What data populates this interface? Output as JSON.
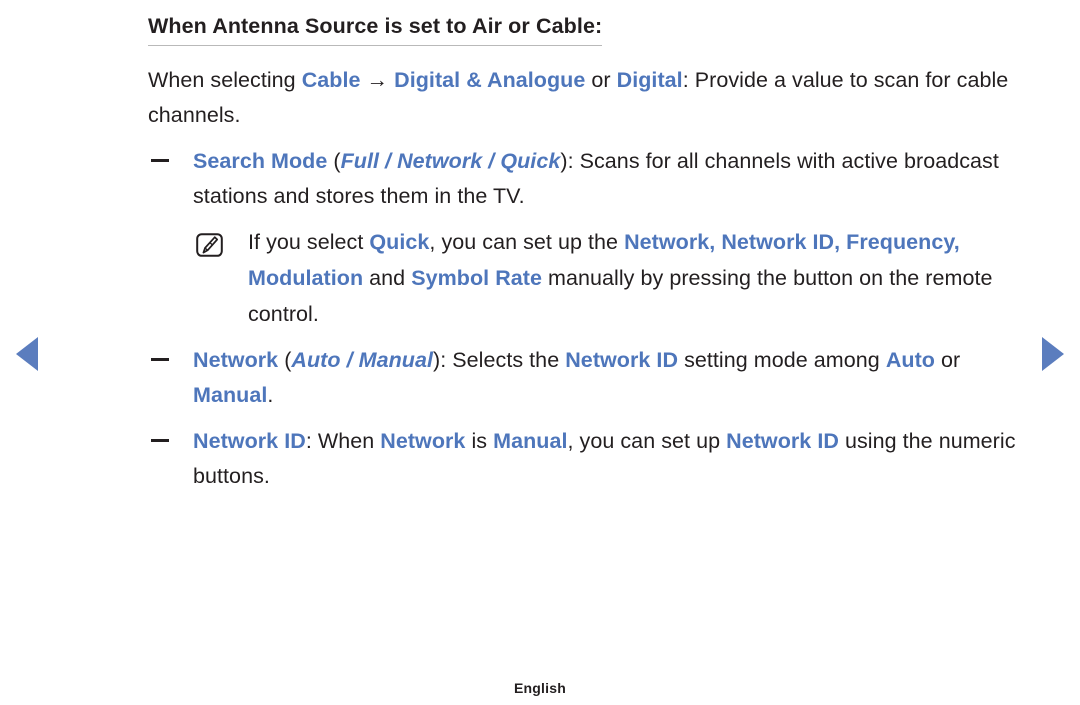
{
  "document": {
    "title": "When Antenna Source is set to Air or Cable:",
    "footer_language": "English"
  },
  "navigation": {
    "prev_label": "◀",
    "next_label": "▶"
  },
  "colors": {
    "highlight_blue": "#4e76bb",
    "text_dark": "#231f20",
    "rule_gray": "#b9b9b9",
    "arrow_blue": "#5b7dbe"
  },
  "icons": {
    "note": "note-pencil-icon"
  },
  "intro": {
    "p1_a": "When selecting ",
    "p1_cable": "Cable",
    "p1_arrow": " → ",
    "p1_digital_analogue": "Digital & Analogue",
    "p1_b": " or ",
    "p1_digital": "Digital",
    "p1_c": ": Provide a value to scan for cable channels."
  },
  "bullets": [
    {
      "term": "Search Mode",
      "open_paren": " (",
      "options": "Full / Network / Quick",
      "close_paren": ")",
      "body": ": Scans for all channels with active broadcast stations and stores them in the TV."
    },
    {
      "term": "Network",
      "open_paren": " (",
      "options": "Auto / Manual",
      "close_paren": ")",
      "body_a": ": Selects the ",
      "body_term": "Network ID",
      "body_b": " setting mode among ",
      "body_opt1": "Auto",
      "body_mid": " or ",
      "body_opt2": "Manual",
      "body_end": "."
    },
    {
      "term": "Network ID",
      "body_a": ": When ",
      "body_term1": "Network",
      "body_b": " is ",
      "body_term2": "Manual",
      "body_c": ", you can set up ",
      "body_term3": "Network ID",
      "body_d": " using the numeric buttons."
    }
  ],
  "note": {
    "a": "If you select ",
    "quick": "Quick",
    "b": ", you can set up the ",
    "terms1": "Network, Network ID, Frequency, Modulation",
    "c": " and ",
    "terms2": "Symbol Rate",
    "d": " manually by pressing the button on the remote control."
  }
}
